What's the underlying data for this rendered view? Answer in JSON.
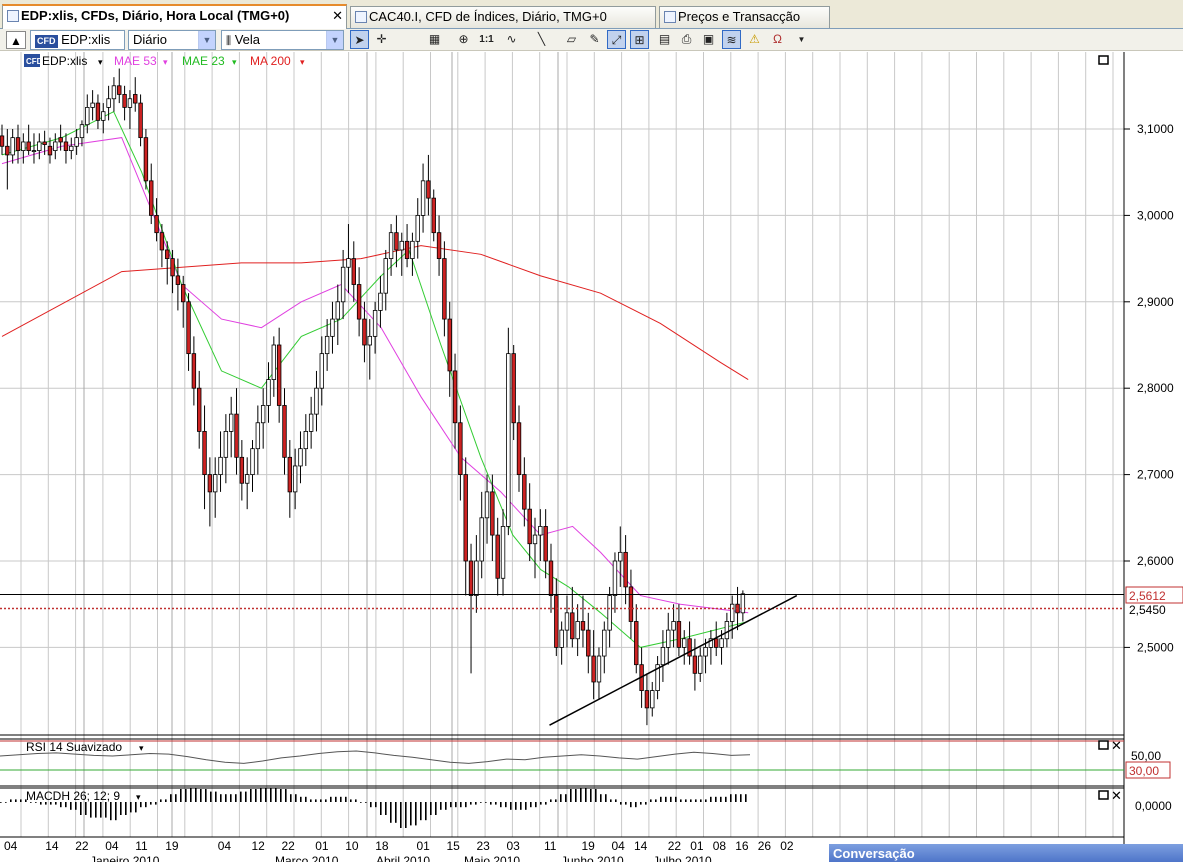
{
  "tabs": [
    {
      "label": "EDP:xlis, CFDs, Diário, Hora Local (TMG+0)",
      "active": true,
      "close": "✕"
    },
    {
      "label": "CAC40.I, CFD de Índices, Diário, TMG+0",
      "active": false
    },
    {
      "label": "Preços e Transacção",
      "active": false
    }
  ],
  "toolbar": {
    "symbol": "EDP:xlis",
    "symbol_badge": "CFD",
    "period": "Diário",
    "chart_type": "Vela",
    "tools": [
      "cursor-icon",
      "crosshair-icon",
      "grid-icon",
      "zoom-icon",
      "one-to-one-icon",
      "indicators-icon",
      "line-icon",
      "eraser-icon",
      "drawing-icon",
      "autoscale-icon",
      "layout-icon",
      "template-icon",
      "print-icon",
      "save-icon",
      "compare-icon",
      "alert-icon",
      "magnet-icon"
    ]
  },
  "legend": {
    "symbol": "EDP:xlis",
    "items": [
      {
        "label": "MAE 53",
        "color": "#e040e0"
      },
      {
        "label": "MAE 23",
        "color": "#33cc33"
      },
      {
        "label": "MA 200",
        "color": "#e02020"
      }
    ]
  },
  "colors": {
    "up": "#ffffff",
    "down": "#cc2222",
    "outline": "#000000",
    "grid": "#c8c8c8"
  },
  "chart_data": {
    "type": "candlestick",
    "y_ticks": [
      "3,1000",
      "3,0000",
      "2,9000",
      "2,8000",
      "2,7000",
      "2,6000",
      "2,5000"
    ],
    "ylim": [
      2.405,
      3.17
    ],
    "current_price_label": "2,5612",
    "current_price": 2.5612,
    "dotted_level_label": "2,5450",
    "dotted_level": 2.545,
    "date_labels": [
      "04",
      "14",
      "22",
      "04",
      "11",
      "19",
      "04",
      "12",
      "22",
      "01",
      "10",
      "18",
      "01",
      "15",
      "23",
      "03",
      "11",
      "19",
      "04",
      "14",
      "22",
      "01",
      "08",
      "16",
      "26",
      "02"
    ],
    "month_labels": [
      "Janeiro 2010",
      "Março 2010",
      "Abril 2010",
      "Maio 2010",
      "Junho 2010",
      "Julho 2010"
    ],
    "price_candles": [
      [
        3.092,
        3.105,
        3.07,
        3.08
      ],
      [
        3.08,
        3.1,
        3.03,
        3.07
      ],
      [
        3.07,
        3.1,
        3.06,
        3.09
      ],
      [
        3.09,
        3.105,
        3.06,
        3.075
      ],
      [
        3.075,
        3.095,
        3.06,
        3.085
      ],
      [
        3.085,
        3.105,
        3.07,
        3.075
      ],
      [
        3.075,
        3.095,
        3.06,
        3.075
      ],
      [
        3.075,
        3.095,
        3.065,
        3.085
      ],
      [
        3.085,
        3.098,
        3.07,
        3.082
      ],
      [
        3.08,
        3.09,
        3.06,
        3.07
      ],
      [
        3.075,
        3.095,
        3.065,
        3.085
      ],
      [
        3.09,
        3.105,
        3.075,
        3.085
      ],
      [
        3.085,
        3.095,
        3.06,
        3.075
      ],
      [
        3.075,
        3.09,
        3.065,
        3.08
      ],
      [
        3.08,
        3.1,
        3.07,
        3.09
      ],
      [
        3.09,
        3.11,
        3.08,
        3.105
      ],
      [
        3.105,
        3.14,
        3.095,
        3.125
      ],
      [
        3.125,
        3.145,
        3.11,
        3.13
      ],
      [
        3.13,
        3.14,
        3.1,
        3.11
      ],
      [
        3.11,
        3.13,
        3.095,
        3.12
      ],
      [
        3.125,
        3.15,
        3.11,
        3.135
      ],
      [
        3.135,
        3.16,
        3.12,
        3.15
      ],
      [
        3.15,
        3.17,
        3.13,
        3.14
      ],
      [
        3.14,
        3.15,
        3.11,
        3.125
      ],
      [
        3.125,
        3.145,
        3.1,
        3.135
      ],
      [
        3.14,
        3.16,
        3.12,
        3.13
      ],
      [
        3.13,
        3.14,
        3.08,
        3.09
      ],
      [
        3.09,
        3.1,
        3.03,
        3.04
      ],
      [
        3.04,
        3.06,
        2.99,
        3.0
      ],
      [
        3.0,
        3.02,
        2.97,
        2.98
      ],
      [
        2.98,
        2.99,
        2.94,
        2.96
      ],
      [
        2.96,
        2.97,
        2.92,
        2.95
      ],
      [
        2.95,
        2.96,
        2.91,
        2.93
      ],
      [
        2.93,
        2.95,
        2.89,
        2.92
      ],
      [
        2.92,
        2.93,
        2.87,
        2.9
      ],
      [
        2.9,
        2.91,
        2.82,
        2.84
      ],
      [
        2.84,
        2.86,
        2.78,
        2.8
      ],
      [
        2.8,
        2.82,
        2.73,
        2.75
      ],
      [
        2.75,
        2.78,
        2.66,
        2.7
      ],
      [
        2.7,
        2.72,
        2.64,
        2.68
      ],
      [
        2.68,
        2.72,
        2.65,
        2.7
      ],
      [
        2.7,
        2.75,
        2.68,
        2.72
      ],
      [
        2.72,
        2.77,
        2.69,
        2.75
      ],
      [
        2.75,
        2.79,
        2.72,
        2.77
      ],
      [
        2.77,
        2.8,
        2.7,
        2.72
      ],
      [
        2.72,
        2.74,
        2.67,
        2.69
      ],
      [
        2.69,
        2.72,
        2.66,
        2.7
      ],
      [
        2.7,
        2.74,
        2.68,
        2.73
      ],
      [
        2.73,
        2.78,
        2.7,
        2.76
      ],
      [
        2.76,
        2.8,
        2.73,
        2.78
      ],
      [
        2.78,
        2.83,
        2.76,
        2.81
      ],
      [
        2.81,
        2.86,
        2.79,
        2.85
      ],
      [
        2.85,
        2.87,
        2.76,
        2.78
      ],
      [
        2.78,
        2.8,
        2.7,
        2.72
      ],
      [
        2.72,
        2.74,
        2.65,
        2.68
      ],
      [
        2.68,
        2.73,
        2.66,
        2.71
      ],
      [
        2.71,
        2.75,
        2.69,
        2.73
      ],
      [
        2.73,
        2.77,
        2.71,
        2.75
      ],
      [
        2.75,
        2.79,
        2.73,
        2.77
      ],
      [
        2.77,
        2.82,
        2.75,
        2.8
      ],
      [
        2.8,
        2.86,
        2.78,
        2.84
      ],
      [
        2.84,
        2.88,
        2.82,
        2.86
      ],
      [
        2.86,
        2.9,
        2.84,
        2.88
      ],
      [
        2.88,
        2.92,
        2.85,
        2.9
      ],
      [
        2.9,
        2.96,
        2.88,
        2.94
      ],
      [
        2.94,
        2.99,
        2.91,
        2.95
      ],
      [
        2.95,
        2.97,
        2.9,
        2.92
      ],
      [
        2.92,
        2.94,
        2.86,
        2.88
      ],
      [
        2.88,
        2.9,
        2.83,
        2.85
      ],
      [
        2.85,
        2.88,
        2.81,
        2.86
      ],
      [
        2.86,
        2.9,
        2.84,
        2.89
      ],
      [
        2.89,
        2.93,
        2.87,
        2.91
      ],
      [
        2.91,
        2.96,
        2.89,
        2.95
      ],
      [
        2.95,
        2.99,
        2.93,
        2.98
      ],
      [
        2.98,
        3.0,
        2.94,
        2.96
      ],
      [
        2.96,
        2.98,
        2.93,
        2.97
      ],
      [
        2.97,
        2.99,
        2.94,
        2.95
      ],
      [
        2.95,
        2.98,
        2.93,
        2.97
      ],
      [
        2.97,
        3.02,
        2.95,
        3.0
      ],
      [
        3.0,
        3.06,
        2.98,
        3.04
      ],
      [
        3.04,
        3.07,
        3.0,
        3.02
      ],
      [
        3.02,
        3.03,
        2.97,
        2.98
      ],
      [
        2.98,
        3.0,
        2.93,
        2.95
      ],
      [
        2.95,
        2.97,
        2.86,
        2.88
      ],
      [
        2.88,
        2.9,
        2.79,
        2.82
      ],
      [
        2.82,
        2.84,
        2.73,
        2.76
      ],
      [
        2.76,
        2.78,
        2.67,
        2.7
      ],
      [
        2.7,
        2.72,
        2.56,
        2.6
      ],
      [
        2.6,
        2.62,
        2.47,
        2.56
      ],
      [
        2.56,
        2.63,
        2.54,
        2.6
      ],
      [
        2.6,
        2.68,
        2.58,
        2.65
      ],
      [
        2.65,
        2.7,
        2.62,
        2.68
      ],
      [
        2.68,
        2.7,
        2.6,
        2.63
      ],
      [
        2.63,
        2.65,
        2.56,
        2.58
      ],
      [
        2.58,
        2.66,
        2.56,
        2.64
      ],
      [
        2.64,
        2.87,
        2.63,
        2.84
      ],
      [
        2.84,
        2.85,
        2.74,
        2.76
      ],
      [
        2.76,
        2.78,
        2.68,
        2.7
      ],
      [
        2.7,
        2.72,
        2.64,
        2.66
      ],
      [
        2.66,
        2.69,
        2.6,
        2.62
      ],
      [
        2.62,
        2.65,
        2.58,
        2.63
      ],
      [
        2.63,
        2.66,
        2.6,
        2.64
      ],
      [
        2.64,
        2.66,
        2.58,
        2.6
      ],
      [
        2.6,
        2.62,
        2.54,
        2.56
      ],
      [
        2.56,
        2.58,
        2.49,
        2.5
      ],
      [
        2.5,
        2.53,
        2.48,
        2.52
      ],
      [
        2.52,
        2.56,
        2.5,
        2.54
      ],
      [
        2.54,
        2.57,
        2.5,
        2.51
      ],
      [
        2.51,
        2.55,
        2.49,
        2.53
      ],
      [
        2.53,
        2.56,
        2.5,
        2.52
      ],
      [
        2.52,
        2.54,
        2.47,
        2.49
      ],
      [
        2.49,
        2.52,
        2.44,
        2.46
      ],
      [
        2.46,
        2.5,
        2.44,
        2.49
      ],
      [
        2.49,
        2.53,
        2.47,
        2.52
      ],
      [
        2.52,
        2.57,
        2.5,
        2.56
      ],
      [
        2.56,
        2.61,
        2.54,
        2.6
      ],
      [
        2.6,
        2.64,
        2.57,
        2.61
      ],
      [
        2.61,
        2.63,
        2.55,
        2.57
      ],
      [
        2.57,
        2.59,
        2.51,
        2.53
      ],
      [
        2.53,
        2.55,
        2.47,
        2.48
      ],
      [
        2.48,
        2.5,
        2.43,
        2.45
      ],
      [
        2.45,
        2.47,
        2.41,
        2.43
      ],
      [
        2.43,
        2.46,
        2.42,
        2.45
      ],
      [
        2.45,
        2.49,
        2.44,
        2.48
      ],
      [
        2.48,
        2.52,
        2.46,
        2.5
      ],
      [
        2.5,
        2.54,
        2.48,
        2.52
      ],
      [
        2.52,
        2.55,
        2.5,
        2.53
      ],
      [
        2.53,
        2.55,
        2.49,
        2.5
      ],
      [
        2.5,
        2.52,
        2.48,
        2.51
      ],
      [
        2.51,
        2.53,
        2.48,
        2.49
      ],
      [
        2.49,
        2.51,
        2.45,
        2.47
      ],
      [
        2.47,
        2.5,
        2.46,
        2.49
      ],
      [
        2.49,
        2.51,
        2.47,
        2.5
      ],
      [
        2.5,
        2.52,
        2.48,
        2.51
      ],
      [
        2.51,
        2.53,
        2.49,
        2.5
      ],
      [
        2.5,
        2.52,
        2.48,
        2.51
      ],
      [
        2.51,
        2.54,
        2.5,
        2.53
      ],
      [
        2.53,
        2.56,
        2.51,
        2.55
      ],
      [
        2.55,
        2.57,
        2.52,
        2.54
      ],
      [
        2.54,
        2.566,
        2.53,
        2.562
      ]
    ],
    "ma200": [
      [
        0,
        2.86
      ],
      [
        30,
        2.935
      ],
      [
        60,
        2.945
      ],
      [
        75,
        2.945
      ],
      [
        90,
        2.95
      ],
      [
        105,
        2.965
      ],
      [
        120,
        2.955
      ],
      [
        135,
        2.93
      ],
      [
        150,
        2.91
      ],
      [
        165,
        2.875
      ],
      [
        180,
        2.83
      ],
      [
        187,
        2.81
      ]
    ],
    "mae53": [
      [
        0,
        3.06
      ],
      [
        15,
        3.08
      ],
      [
        30,
        3.09
      ],
      [
        38,
        3.0
      ],
      [
        45,
        2.92
      ],
      [
        55,
        2.88
      ],
      [
        65,
        2.87
      ],
      [
        75,
        2.9
      ],
      [
        85,
        2.92
      ],
      [
        95,
        2.87
      ],
      [
        105,
        2.79
      ],
      [
        115,
        2.72
      ],
      [
        125,
        2.68
      ],
      [
        135,
        2.63
      ],
      [
        143,
        2.64
      ],
      [
        150,
        2.61
      ],
      [
        160,
        2.56
      ],
      [
        170,
        2.55
      ],
      [
        187,
        2.54
      ]
    ],
    "mae23": [
      [
        0,
        3.07
      ],
      [
        15,
        3.09
      ],
      [
        28,
        3.12
      ],
      [
        35,
        3.05
      ],
      [
        45,
        2.92
      ],
      [
        55,
        2.82
      ],
      [
        65,
        2.8
      ],
      [
        75,
        2.86
      ],
      [
        85,
        2.88
      ],
      [
        95,
        2.93
      ],
      [
        102,
        2.96
      ],
      [
        110,
        2.85
      ],
      [
        120,
        2.72
      ],
      [
        128,
        2.63
      ],
      [
        135,
        2.59
      ],
      [
        142,
        2.57
      ],
      [
        150,
        2.54
      ],
      [
        160,
        2.5
      ],
      [
        170,
        2.51
      ],
      [
        187,
        2.53
      ]
    ],
    "trendline": [
      [
        2.41,
        160
      ],
      [
        2.56,
        198
      ]
    ],
    "rsi": {
      "label": "RSI 14 Suavizado",
      "levels": [
        "50,00",
        "30,00"
      ],
      "values": [
        50,
        52,
        54,
        55,
        53,
        51,
        50,
        52,
        54,
        53,
        49,
        44,
        40,
        38,
        42,
        47,
        50,
        54,
        57,
        58,
        55,
        51,
        48,
        44,
        40,
        38,
        41,
        45,
        44,
        48,
        50,
        52,
        50,
        47,
        45,
        49,
        53,
        56,
        54,
        51,
        52
      ]
    },
    "macd": {
      "label": "MACDH 26; 12; 9",
      "level": "0,0000",
      "values": [
        0,
        0.1,
        0.1,
        0,
        -0.1,
        -0.1,
        -0.2,
        -0.3,
        -0.5,
        -0.6,
        -0.6,
        -0.7,
        -0.5,
        -0.4,
        -0.2,
        -0.1,
        0.1,
        0.3,
        0.5,
        0.6,
        0.5,
        0.4,
        0.3,
        0.3,
        0.4,
        0.5,
        0.6,
        0.6,
        0.5,
        0.3,
        0.2,
        0.1,
        0.1,
        0.2,
        0.2,
        0.1,
        0,
        -0.2,
        -0.5,
        -0.8,
        -1.0,
        -0.9,
        -0.7,
        -0.5,
        -0.3,
        -0.2,
        -0.2,
        -0.1,
        0,
        -0.1,
        -0.2,
        -0.3,
        -0.3,
        -0.2,
        -0.1,
        0.1,
        0.3,
        0.5,
        0.6,
        0.5,
        0.3,
        0.1,
        -0.1,
        -0.2,
        -0.1,
        0.1,
        0.2,
        0.2,
        0.1,
        0.1,
        0.1,
        0.2,
        0.2,
        0.3,
        0.3
      ]
    }
  },
  "footer": {
    "conversation": "Conversação"
  }
}
